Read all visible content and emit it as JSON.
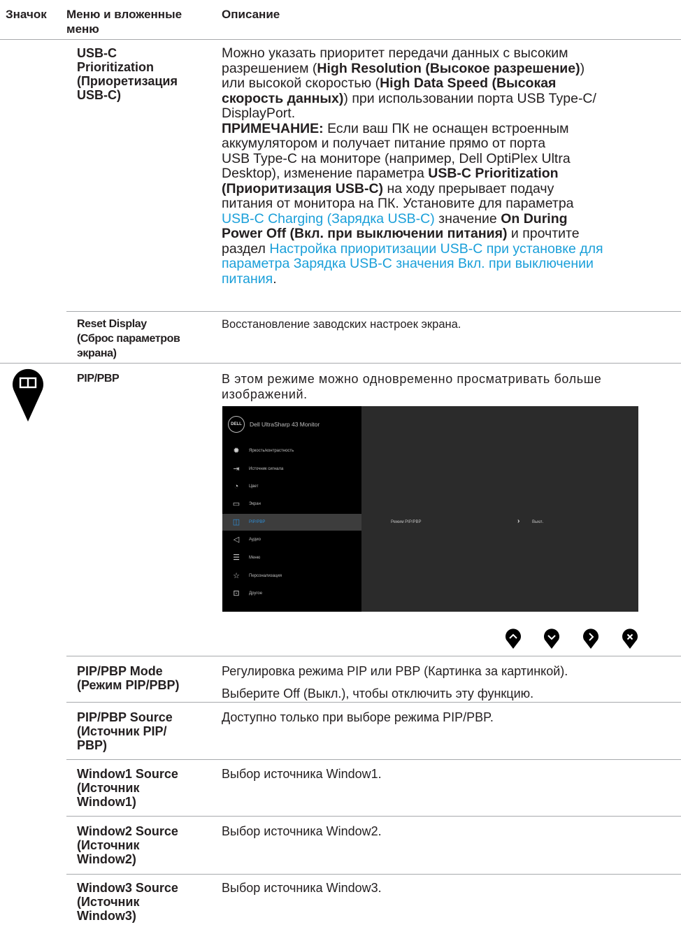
{
  "headers": {
    "icon": "Значок",
    "menu_line1": "Меню и вложенные",
    "menu_line2": "меню",
    "description": "Описание"
  },
  "rows": {
    "usbc": {
      "name_lines": [
        "USB-C",
        "Prioritization",
        "(Приоретизация",
        "USB-C)"
      ],
      "desc": {
        "p1_a": "Можно указать приоритет передачи данных с высоким",
        "p1_b": "разрешением (",
        "p1_b_bold": "High Resolution (Высокое разрешение)",
        "p1_b_end": ")",
        "p1_c": "или высокой скоростью (",
        "p1_c_bold": "High Data Speed (Высокая",
        "p1_d_bold": "скорость данных)",
        "p1_d": ") при использовании порта USB Type-C/",
        "p1_e": "DisplayPort.",
        "note_label": "ПРИМЕЧАНИЕ:",
        "n1": " Если ваш ПК не оснащен встроенным",
        "n2": "аккумулятором и получает питание прямо от порта",
        "n3": "USB Type-C на мониторе (например, Dell OptiPlex Ultra",
        "n4": "Desktop), изменение параметра ",
        "n4_bold": "USB-C Prioritization",
        "n5_bold": "(Приоритизация USB-C)",
        "n5": " на ходу прерывает подачу",
        "n6": "питания от монитора на ПК. Установите для параметра",
        "n7_link": "USB-C Charging (Зарядка USB-C)",
        "n7": " значение ",
        "n7_bold": "On During",
        "n8_bold": "Power Off (Вкл. при выключении питания)",
        "n8": " и прочтите",
        "n9": "раздел ",
        "n9_link": "Настройка приоритизации USB-C при установке для",
        "n10_link": "параметра Зарядка USB-C значения Вкл. при выключении",
        "n11_link": "питания",
        "n11": "."
      }
    },
    "reset": {
      "name_lines": [
        "Reset Display",
        "(Сброс параметров",
        "экрана)"
      ],
      "desc": "Восстановление заводских настроек экрана."
    },
    "pip": {
      "name": "PIP/PBP",
      "desc_l1": "В этом режиме можно одновременно просматривать больше",
      "desc_l2": "изображений."
    },
    "pip_mode": {
      "name_lines": [
        "PIP/PBP Mode",
        "(Режим PIP/PBP)"
      ],
      "desc_l1": "Регулировка режима PIP или PBP (Картинка за картинкой).",
      "desc_l2": "Выберите Off (Выкл.), чтобы отключить эту функцию."
    },
    "pip_source": {
      "name_lines": [
        "PIP/PBP Source",
        "(Источник PIP/",
        "PBP)"
      ],
      "desc": "Доступно только при выборе режима PIP/PBP."
    },
    "w1": {
      "name_lines": [
        "Window1 Source",
        "(Источник",
        "Window1)"
      ],
      "desc": "Выбор источника Window1."
    },
    "w2": {
      "name_lines": [
        "Window2 Source",
        "(Источник",
        "Window2)"
      ],
      "desc": "Выбор источника Window2."
    },
    "w3": {
      "name_lines": [
        "Window3 Source",
        "(Источник",
        "Window3)"
      ],
      "desc": "Выбор источника Window3."
    }
  },
  "osd": {
    "logo": "DELL",
    "title": "Dell UltraSharp 43 Monitor",
    "items": [
      {
        "label": "Яркость/контрастность",
        "icon": "brightness-icon",
        "selected": false
      },
      {
        "label": "Источник сигнала",
        "icon": "input-source-icon",
        "selected": false
      },
      {
        "label": "Цвет",
        "icon": "color-palette-icon",
        "selected": false
      },
      {
        "label": "Экран",
        "icon": "display-icon",
        "selected": false
      },
      {
        "label": "PIP/PBP",
        "icon": "pip-icon",
        "selected": true
      },
      {
        "label": "Аудио",
        "icon": "speaker-icon",
        "selected": false
      },
      {
        "label": "Меню",
        "icon": "menu-icon",
        "selected": false
      },
      {
        "label": "Персонализация",
        "icon": "star-icon",
        "selected": false
      },
      {
        "label": "Другое",
        "icon": "other-icon",
        "selected": false
      }
    ],
    "submenu_label": "Режим PIP/PBP",
    "submenu_value": "Выкл."
  },
  "nav_buttons": [
    "up-arrow-icon",
    "down-arrow-icon",
    "right-arrow-icon",
    "close-icon"
  ],
  "colors": {
    "link": "#1a9fd9",
    "rule": "#a7a9ac",
    "osd_accent": "#2f8fd8"
  }
}
